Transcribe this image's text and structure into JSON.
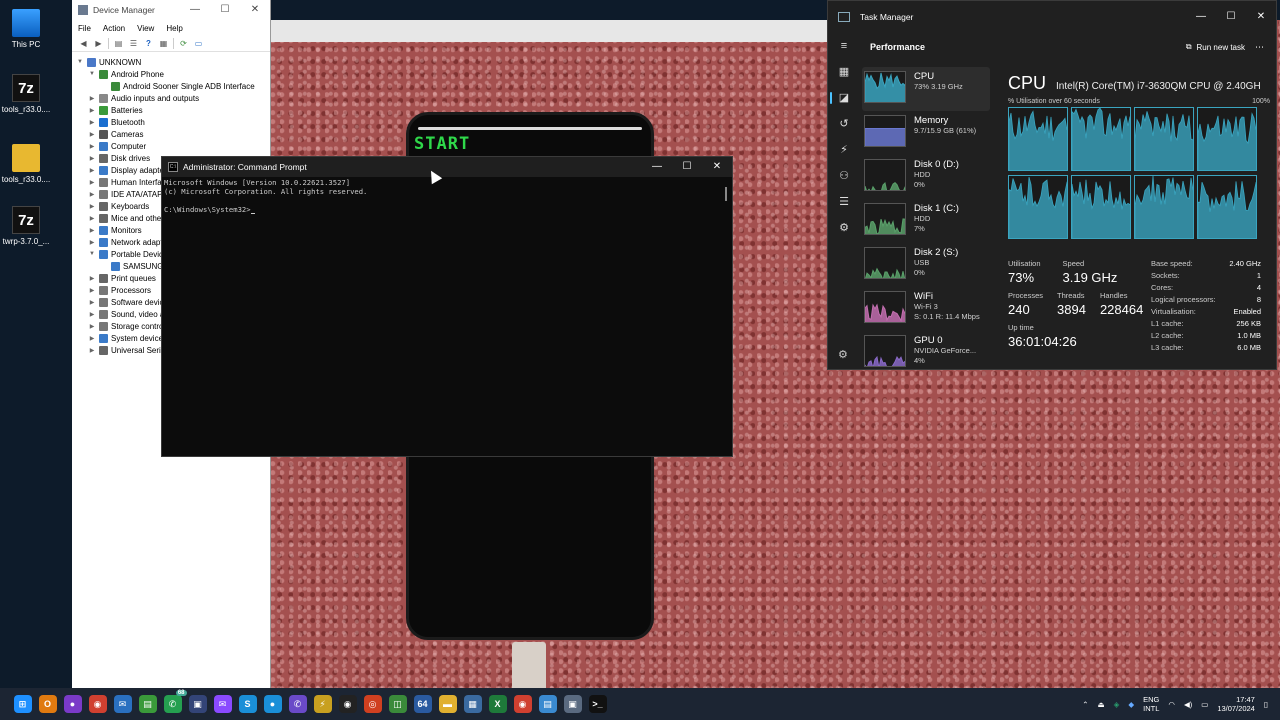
{
  "desktop": {
    "icons": [
      {
        "label": "This PC",
        "icon": "computer-icon"
      },
      {
        "label": "tools_r33.0....",
        "icon": "7zip-icon",
        "glyph": "7z"
      },
      {
        "label": "tools_r33.0....",
        "icon": "folder-icon"
      },
      {
        "label": "twrp-3.7.0_...",
        "icon": "7zip-icon",
        "glyph": "7z"
      }
    ]
  },
  "phone": {
    "screen_text": "START"
  },
  "device_manager": {
    "title": "Device Manager",
    "menu": [
      "File",
      "Action",
      "View",
      "Help"
    ],
    "tree": [
      {
        "label": "UNKNOWN",
        "level": 0,
        "expanded": true,
        "color": "#4a78c8"
      },
      {
        "label": "Android Phone",
        "level": 1,
        "expanded": true,
        "color": "#3a8a3a"
      },
      {
        "label": "Android Sooner Single ADB Interface",
        "level": 2,
        "expanded": null,
        "color": "#3a8a3a"
      },
      {
        "label": "Audio inputs and outputs",
        "level": 1,
        "expanded": false,
        "color": "#888888"
      },
      {
        "label": "Batteries",
        "level": 1,
        "expanded": false,
        "color": "#3a9a3a"
      },
      {
        "label": "Bluetooth",
        "level": 1,
        "expanded": false,
        "color": "#1a6fd0"
      },
      {
        "label": "Cameras",
        "level": 1,
        "expanded": false,
        "color": "#555555"
      },
      {
        "label": "Computer",
        "level": 1,
        "expanded": false,
        "color": "#3a7ac8"
      },
      {
        "label": "Disk drives",
        "level": 1,
        "expanded": false,
        "color": "#666666"
      },
      {
        "label": "Display adapters",
        "level": 1,
        "expanded": false,
        "color": "#3a7ac8"
      },
      {
        "label": "Human Interface Devices",
        "level": 1,
        "expanded": false,
        "color": "#777777"
      },
      {
        "label": "IDE ATA/ATAPI controllers",
        "level": 1,
        "expanded": false,
        "color": "#777777"
      },
      {
        "label": "Keyboards",
        "level": 1,
        "expanded": false,
        "color": "#666666"
      },
      {
        "label": "Mice and other pointing devices",
        "level": 1,
        "expanded": false,
        "color": "#666666"
      },
      {
        "label": "Monitors",
        "level": 1,
        "expanded": false,
        "color": "#3a7ac8"
      },
      {
        "label": "Network adapters",
        "level": 1,
        "expanded": false,
        "color": "#3a7ac8"
      },
      {
        "label": "Portable Devices",
        "level": 1,
        "expanded": true,
        "color": "#3a7ac8"
      },
      {
        "label": "SAMSUNG",
        "level": 2,
        "expanded": null,
        "color": "#3a7ac8"
      },
      {
        "label": "Print queues",
        "level": 1,
        "expanded": false,
        "color": "#666666"
      },
      {
        "label": "Processors",
        "level": 1,
        "expanded": false,
        "color": "#777777"
      },
      {
        "label": "Software devices",
        "level": 1,
        "expanded": false,
        "color": "#777777"
      },
      {
        "label": "Sound, video and game controllers",
        "level": 1,
        "expanded": false,
        "color": "#777777"
      },
      {
        "label": "Storage controllers",
        "level": 1,
        "expanded": false,
        "color": "#777777"
      },
      {
        "label": "System devices",
        "level": 1,
        "expanded": false,
        "color": "#3a7ac8"
      },
      {
        "label": "Universal Serial Bus controllers",
        "level": 1,
        "expanded": false,
        "color": "#666666"
      }
    ]
  },
  "cmd": {
    "title": "Administrator: Command Prompt",
    "icon_glyph": "C:\\",
    "lines": [
      "Microsoft Windows [Version 10.0.22621.3527]",
      "(c) Microsoft Corporation. All rights reserved.",
      "",
      "C:\\Windows\\System32>"
    ]
  },
  "task_manager": {
    "title": "Task Manager",
    "section": "Performance",
    "run_new_task": "Run new task",
    "sidebar": [
      {
        "name": "CPU",
        "line1": "73% 3.19 GHz",
        "line2": "",
        "color": "#3aa5c0",
        "active": true
      },
      {
        "name": "Memory",
        "line1": "9.7/15.9 GB (61%)",
        "line2": "",
        "color": "#6a78d0",
        "active": false
      },
      {
        "name": "Disk 0 (D:)",
        "line1": "HDD",
        "line2": "0%",
        "color": "#5aa06a",
        "active": false
      },
      {
        "name": "Disk 1 (C:)",
        "line1": "HDD",
        "line2": "7%",
        "color": "#5aa06a",
        "active": false
      },
      {
        "name": "Disk 2 (S:)",
        "line1": "USB",
        "line2": "0%",
        "color": "#5aa06a",
        "active": false
      },
      {
        "name": "WiFi",
        "line1": "Wi-Fi 3",
        "line2": "S: 0.1 R: 11.4 Mbps",
        "color": "#c36fb0",
        "active": false
      },
      {
        "name": "GPU 0",
        "line1": "NVIDIA GeForce...",
        "line2": "4%",
        "color": "#8a6ac8",
        "active": false
      }
    ],
    "cpu": {
      "heading": "CPU",
      "model": "Intel(R) Core(TM) i7-3630QM CPU @ 2.40GHz",
      "util_label": "% Utilisation over 60 seconds",
      "util_max": "100%",
      "graph_color": "#3aa5c0",
      "core_levels": [
        0.72,
        0.75,
        0.7,
        0.68,
        0.74,
        0.71,
        0.76,
        0.69
      ]
    },
    "stats": {
      "utilisation_label": "Utilisation",
      "utilisation": "73%",
      "speed_label": "Speed",
      "speed": "3.19 GHz",
      "processes_label": "Processes",
      "processes": "240",
      "threads_label": "Threads",
      "threads": "3894",
      "handles_label": "Handles",
      "handles": "228464",
      "uptime_label": "Up time",
      "uptime": "36:01:04:26"
    },
    "details": [
      {
        "k": "Base speed:",
        "v": "2.40 GHz"
      },
      {
        "k": "Sockets:",
        "v": "1"
      },
      {
        "k": "Cores:",
        "v": "4"
      },
      {
        "k": "Logical processors:",
        "v": "8"
      },
      {
        "k": "Virtualisation:",
        "v": "Enabled"
      },
      {
        "k": "L1 cache:",
        "v": "256 KB"
      },
      {
        "k": "L2 cache:",
        "v": "1.0 MB"
      },
      {
        "k": "L3 cache:",
        "v": "6.0 MB"
      }
    ]
  },
  "taskbar": {
    "apps": [
      {
        "icon": "windows-start-icon",
        "color": "#1e90ff",
        "glyph": "⊞"
      },
      {
        "icon": "app-orange-icon",
        "color": "#e07a10",
        "glyph": "O"
      },
      {
        "icon": "app-purple-icon",
        "color": "#7a3ac8",
        "glyph": "●"
      },
      {
        "icon": "chrome-icon",
        "color": "#d04030",
        "glyph": "◉"
      },
      {
        "icon": "app-blue-icon",
        "color": "#2a70c0",
        "glyph": "✉"
      },
      {
        "icon": "app-green-icon",
        "color": "#3a9a3a",
        "glyph": "▤"
      },
      {
        "icon": "whatsapp-icon",
        "color": "#25a050",
        "glyph": "✆",
        "badge": "68"
      },
      {
        "icon": "app-navy-icon",
        "color": "#334477",
        "glyph": "▣"
      },
      {
        "icon": "messenger-icon",
        "color": "#8a4aff",
        "glyph": "✉"
      },
      {
        "icon": "skype-icon",
        "color": "#1a8fd8",
        "glyph": "S"
      },
      {
        "icon": "app-circle-icon",
        "color": "#1a8fd8",
        "glyph": "●"
      },
      {
        "icon": "viber-icon",
        "color": "#6a4ac8",
        "glyph": "✆"
      },
      {
        "icon": "app-yellow-icon",
        "color": "#c8a020",
        "glyph": "⚡"
      },
      {
        "icon": "app-eye-icon",
        "color": "#222222",
        "glyph": "◉"
      },
      {
        "icon": "app-red-circle-icon",
        "color": "#d04020",
        "glyph": "◎"
      },
      {
        "icon": "app-green-box-icon",
        "color": "#3a8a3a",
        "glyph": "◫"
      },
      {
        "icon": "app-64-icon",
        "color": "#2a5aa0",
        "glyph": "64"
      },
      {
        "icon": "file-explorer-icon",
        "color": "#e0b030",
        "glyph": "▬"
      },
      {
        "icon": "app-image-icon",
        "color": "#3a6aa0",
        "glyph": "▦"
      },
      {
        "icon": "excel-icon",
        "color": "#1e7a3a",
        "glyph": "X"
      },
      {
        "icon": "chrome-icon",
        "color": "#d04030",
        "glyph": "◉"
      },
      {
        "icon": "notepad-icon",
        "color": "#3a8ad0",
        "glyph": "▤"
      },
      {
        "icon": "device-manager-icon",
        "color": "#5a6a80",
        "glyph": "▣"
      },
      {
        "icon": "command-prompt-icon",
        "color": "#111111",
        "glyph": ">_"
      }
    ],
    "lang_top": "ENG",
    "lang_bottom": "INTL",
    "time": "17:47",
    "date": "13/07/2024"
  }
}
